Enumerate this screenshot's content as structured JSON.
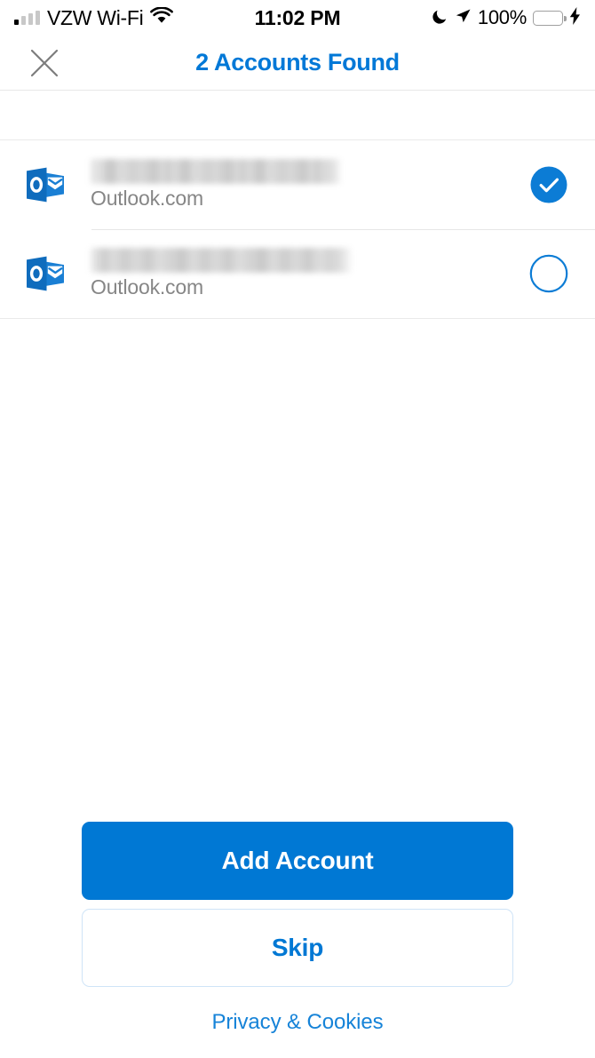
{
  "status_bar": {
    "carrier": "VZW Wi-Fi",
    "time": "11:02 PM",
    "battery_percent": "100%",
    "signal_bars_filled": 1,
    "signal_bars_total": 4,
    "icons": [
      "signal-bars-icon",
      "wifi-icon",
      "do-not-disturb-moon-icon",
      "location-arrow-icon",
      "battery-icon",
      "charging-bolt-icon"
    ],
    "battery_fill_color": "#4cd964"
  },
  "nav": {
    "title": "2 Accounts Found",
    "title_color": "#0078d7",
    "close_icon": "close-x-icon"
  },
  "accounts": {
    "rows": [
      {
        "email": "",
        "email_redacted": true,
        "provider": "Outlook.com",
        "icon": "outlook-logo-icon",
        "selected": true
      },
      {
        "email": "",
        "email_redacted": true,
        "provider": "Outlook.com",
        "icon": "outlook-logo-icon",
        "selected": false
      }
    ]
  },
  "bottom": {
    "primary_button": "Add Account",
    "secondary_button": "Skip",
    "footer_link": "Privacy & Cookies"
  },
  "colors": {
    "accent_blue": "#0078d4",
    "link_blue": "#1683d8",
    "title_blue": "#0078d7",
    "outlook_blue": "#0f6cbd",
    "muted_gray": "#868686",
    "divider": "#e6e6e6"
  }
}
